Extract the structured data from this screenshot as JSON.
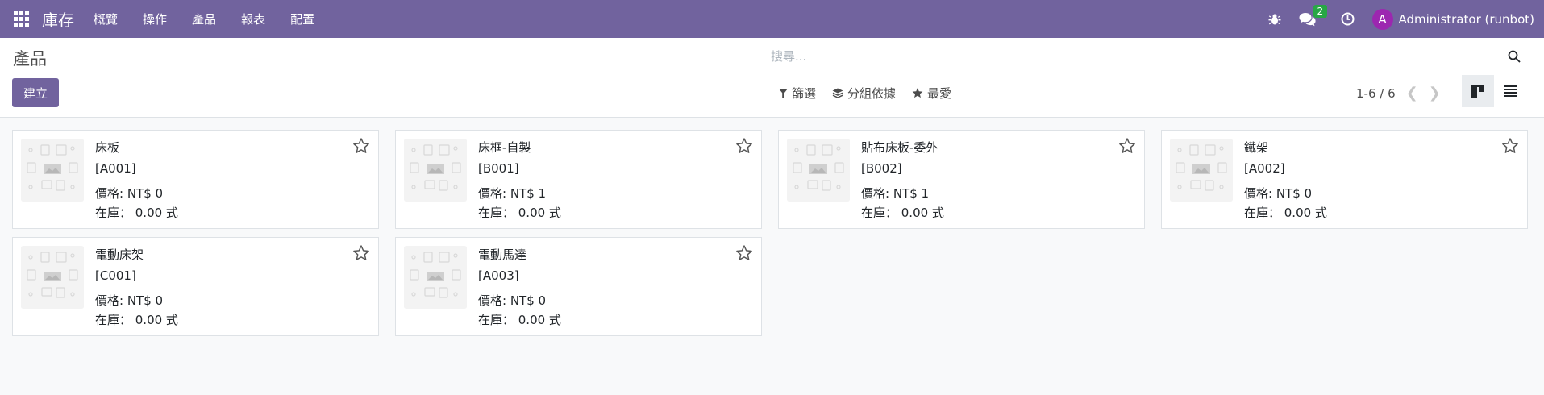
{
  "navbar": {
    "app_name": "庫存",
    "menu": [
      "概覽",
      "操作",
      "產品",
      "報表",
      "配置"
    ],
    "messages_badge": "2",
    "user_initial": "A",
    "user_name": "Administrator (runbot)",
    "brand_color": "#71639e"
  },
  "control_panel": {
    "title": "產品",
    "create_label": "建立",
    "search_placeholder": "搜尋...",
    "filter_label": "篩選",
    "group_label": "分組依據",
    "favorite_label": "最愛",
    "pager": "1-6 / 6"
  },
  "products": [
    {
      "name": "床板",
      "ref": "[A001]",
      "price": "價格: NT$ 0",
      "stock_label": "在庫：",
      "stock_value": "0.00 式"
    },
    {
      "name": "床框-自製",
      "ref": "[B001]",
      "price": "價格: NT$ 1",
      "stock_label": "在庫：",
      "stock_value": "0.00 式"
    },
    {
      "name": "貼布床板-委外",
      "ref": "[B002]",
      "price": "價格: NT$ 1",
      "stock_label": "在庫：",
      "stock_value": "0.00 式"
    },
    {
      "name": "鐵架",
      "ref": "[A002]",
      "price": "價格: NT$ 0",
      "stock_label": "在庫：",
      "stock_value": "0.00 式"
    },
    {
      "name": "電動床架",
      "ref": "[C001]",
      "price": "價格: NT$ 0",
      "stock_label": "在庫：",
      "stock_value": "0.00 式"
    },
    {
      "name": "電動馬達",
      "ref": "[A003]",
      "price": "價格: NT$ 0",
      "stock_label": "在庫：",
      "stock_value": "0.00 式"
    }
  ]
}
